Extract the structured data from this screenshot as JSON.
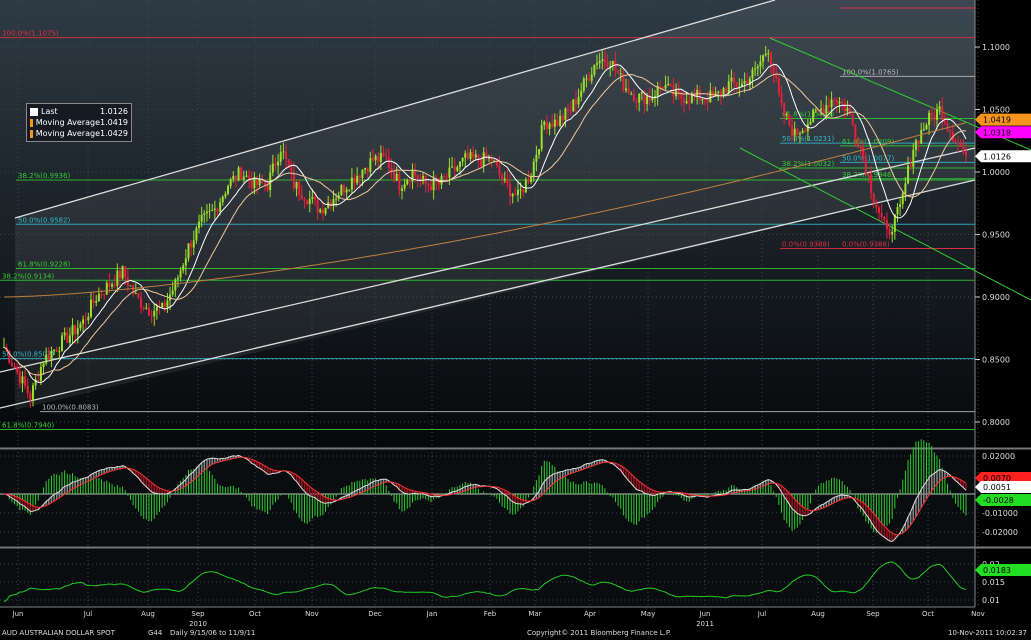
{
  "chart_data": {
    "type": "candlestick",
    "title": "AUD AUSTRALIAN DOLLAR SPOT",
    "ylim": [
      0.78,
      1.135
    ],
    "y_ticks": [
      "1.1000",
      "1.0500",
      "1.0000",
      "0.9500",
      "0.9000",
      "0.8500",
      "0.8000"
    ],
    "y_tick_values": [
      1.1,
      1.05,
      1.0,
      0.95,
      0.9,
      0.85,
      0.8
    ],
    "x_ticks": [
      "Jun",
      "Jul",
      "Aug",
      "Sep",
      "Oct",
      "Nov",
      "Dec",
      "Jan",
      "Feb",
      "Mar",
      "Apr",
      "May",
      "Jun",
      "Jul",
      "Aug",
      "Sep",
      "Oct",
      "Nov"
    ],
    "year_labels": [
      "2010",
      "2011"
    ],
    "weekly_closes": [
      0.86,
      0.84,
      0.82,
      0.85,
      0.86,
      0.87,
      0.88,
      0.9,
      0.91,
      0.92,
      0.9,
      0.89,
      0.89,
      0.91,
      0.94,
      0.96,
      0.97,
      0.99,
      1.0,
      0.99,
      0.99,
      1.02,
      0.99,
      0.98,
      0.97,
      0.98,
      0.99,
      1.0,
      1.01,
      1.01,
      0.99,
      1.0,
      0.99,
      0.99,
      1.0,
      1.01,
      1.01,
      1.01,
      0.99,
      0.98,
      1.0,
      1.04,
      1.04,
      1.05,
      1.07,
      1.09,
      1.09,
      1.07,
      1.06,
      1.06,
      1.07,
      1.06,
      1.06,
      1.06,
      1.06,
      1.07,
      1.07,
      1.08,
      1.1,
      1.05,
      1.03,
      1.04,
      1.05,
      1.06,
      1.05,
      1.02,
      0.98,
      0.95,
      0.97,
      1.02,
      1.04,
      1.05,
      1.03,
      1.0126
    ],
    "legend": [
      {
        "label": "Last",
        "value": "1.0126",
        "color": "#ffffff"
      },
      {
        "label": "Moving Average",
        "value": "1.0419",
        "color": "#f7941d"
      },
      {
        "label": "Moving Average",
        "value": "1.0429",
        "color": "#f7941d"
      }
    ],
    "fib_levels": [
      {
        "label": "100.0%(1.1075)",
        "value": 1.1075,
        "color": "#e03040"
      },
      {
        "label": "100.0%(1.0765)",
        "value": 1.0765,
        "color": "#bbbbbb"
      },
      {
        "label": "61.8%(1.0428)",
        "value": 1.0428,
        "color": "#33cc33"
      },
      {
        "label": "50.0%(1.0231)",
        "value": 1.0231,
        "color": "#33bbcc"
      },
      {
        "label": "61.8%(1.0209)",
        "value": 1.0209,
        "color": "#33cc33"
      },
      {
        "label": "50.0%(1.0077)",
        "value": 1.0077,
        "color": "#33bbcc"
      },
      {
        "label": "38.2%(1.0032)",
        "value": 1.0032,
        "color": "#33cc33"
      },
      {
        "label": "38.2%(0.9936)",
        "value": 0.9936,
        "color": "#33cc33"
      },
      {
        "label": "38.2%(0.9946)",
        "value": 0.9946,
        "color": "#33cc33"
      },
      {
        "label": "50.0%(0.9582)",
        "value": 0.9582,
        "color": "#33bbcc"
      },
      {
        "label": "0.0%(0.9388)",
        "value": 0.9388,
        "color": "#e03040"
      },
      {
        "label": "0.0%(0.9388)",
        "value": 0.9388,
        "color": "#e03040"
      },
      {
        "label": "61.8%(0.9228)",
        "value": 0.9228,
        "color": "#33cc33"
      },
      {
        "label": "38.2%(0.9134)",
        "value": 0.9134,
        "color": "#33cc33"
      },
      {
        "label": "50.0%(0.8507)",
        "value": 0.8507,
        "color": "#33bbcc"
      },
      {
        "label": "100.0%(0.8083)",
        "value": 0.8083,
        "color": "#bbbbbb"
      },
      {
        "label": "61.8%(0.7940)",
        "value": 0.794,
        "color": "#33cc33"
      }
    ],
    "price_flags": [
      {
        "value": "1.0419",
        "color": "#f7941d"
      },
      {
        "value": "1.0318",
        "color": "#ff00ff"
      },
      {
        "value": "1.0126",
        "color": "#ffffff"
      }
    ],
    "macd": {
      "ticks": [
        "0.02000",
        "-0.01000",
        "-0.02000"
      ],
      "tick_values": [
        0.02,
        -0.01,
        -0.02
      ],
      "flags": [
        {
          "value": "0.0070",
          "color": "#ff2020"
        },
        {
          "value": "0.0051",
          "color": "#ffffff"
        },
        {
          "value": "-0.0028",
          "color": "#22dd22"
        }
      ]
    },
    "lower": {
      "ticks": [
        "0.02",
        "0.015",
        "0.01"
      ],
      "tick_values": [
        0.02,
        0.015,
        0.01
      ],
      "flags": [
        {
          "value": "0.0183",
          "color": "#22dd22"
        }
      ]
    }
  },
  "footer": {
    "security": "AUD  AUSTRALIAN DOLLAR SPOT",
    "page": "G44",
    "range": "Daily  9/15/06 to 11/9/11",
    "copyright": "Copyright© 2011 Bloomberg Finance L.P.",
    "timestamp": "10-Nov-2011 10:02:37"
  }
}
